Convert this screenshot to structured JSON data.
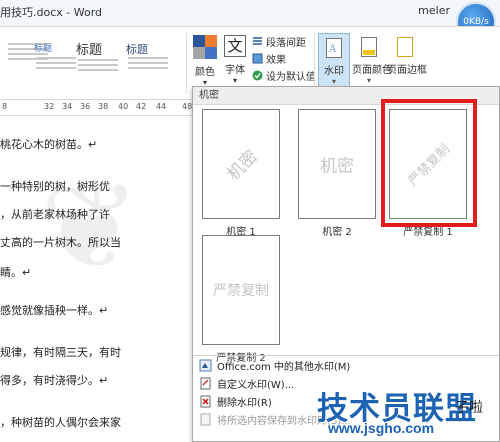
{
  "titlebar": {
    "title": "用技巧.docx - Word",
    "user": "meler",
    "speed": "0KB/s"
  },
  "ribbon": {
    "styles": [
      {
        "preview": "标题",
        "kind": "small"
      },
      {
        "preview": "标题",
        "kind": "small"
      },
      {
        "preview": "标题",
        "kind": "big"
      },
      {
        "preview": "标题",
        "kind": "med"
      }
    ],
    "colors_label": "颜色",
    "font_label": "字体",
    "font_glyph": "文",
    "para_spacing_label": "段落间距",
    "effects_label": "效果",
    "set_default_label": "设为默认值",
    "watermark_label": "水印",
    "page_color_label": "页面颜色",
    "page_border_label": "页面边框",
    "caret": "▾"
  },
  "ruler": {
    "ticks": [
      "8",
      "32",
      "34",
      "36",
      "38",
      "40",
      "42",
      "44",
      "48"
    ]
  },
  "doc": {
    "lines": [
      "桃花心木的树苗。↵",
      "一种特别的树，树形优",
      "，从前老家林场种了许",
      "丈高的一片树木。所以当",
      "睛。↵",
      "感觉就像插秧一样。↵",
      "规律，有时隔三天，有时",
      "得多，有时浇得少。↵",
      "，种树苗的人偶尔会来家"
    ]
  },
  "gallery": {
    "section": "机密",
    "items": [
      {
        "watermark": "机密",
        "caption": "机密 1"
      },
      {
        "watermark": "机密",
        "caption": "机密 2"
      },
      {
        "watermark": "严禁复制",
        "caption": "严禁复制 1"
      },
      {
        "watermark": "严禁复制",
        "caption": "严禁复制 2"
      }
    ],
    "menu": [
      {
        "label": "Office.com 中的其他水印(M)",
        "disabled": false,
        "icon": "office-icon"
      },
      {
        "label": "自定义水印(W)...",
        "disabled": false,
        "icon": "custom-watermark-icon"
      },
      {
        "label": "删除水印(R)",
        "disabled": false,
        "icon": "remove-watermark-icon"
      },
      {
        "label": "将所选内容保存到水印库(S)...",
        "disabled": true,
        "icon": "save-selection-icon"
      }
    ],
    "highlight_color": "#e31c1c"
  },
  "overlay": {
    "logo": "技术员联盟",
    "url": "www.jsgho.com",
    "tag": "子啦"
  }
}
